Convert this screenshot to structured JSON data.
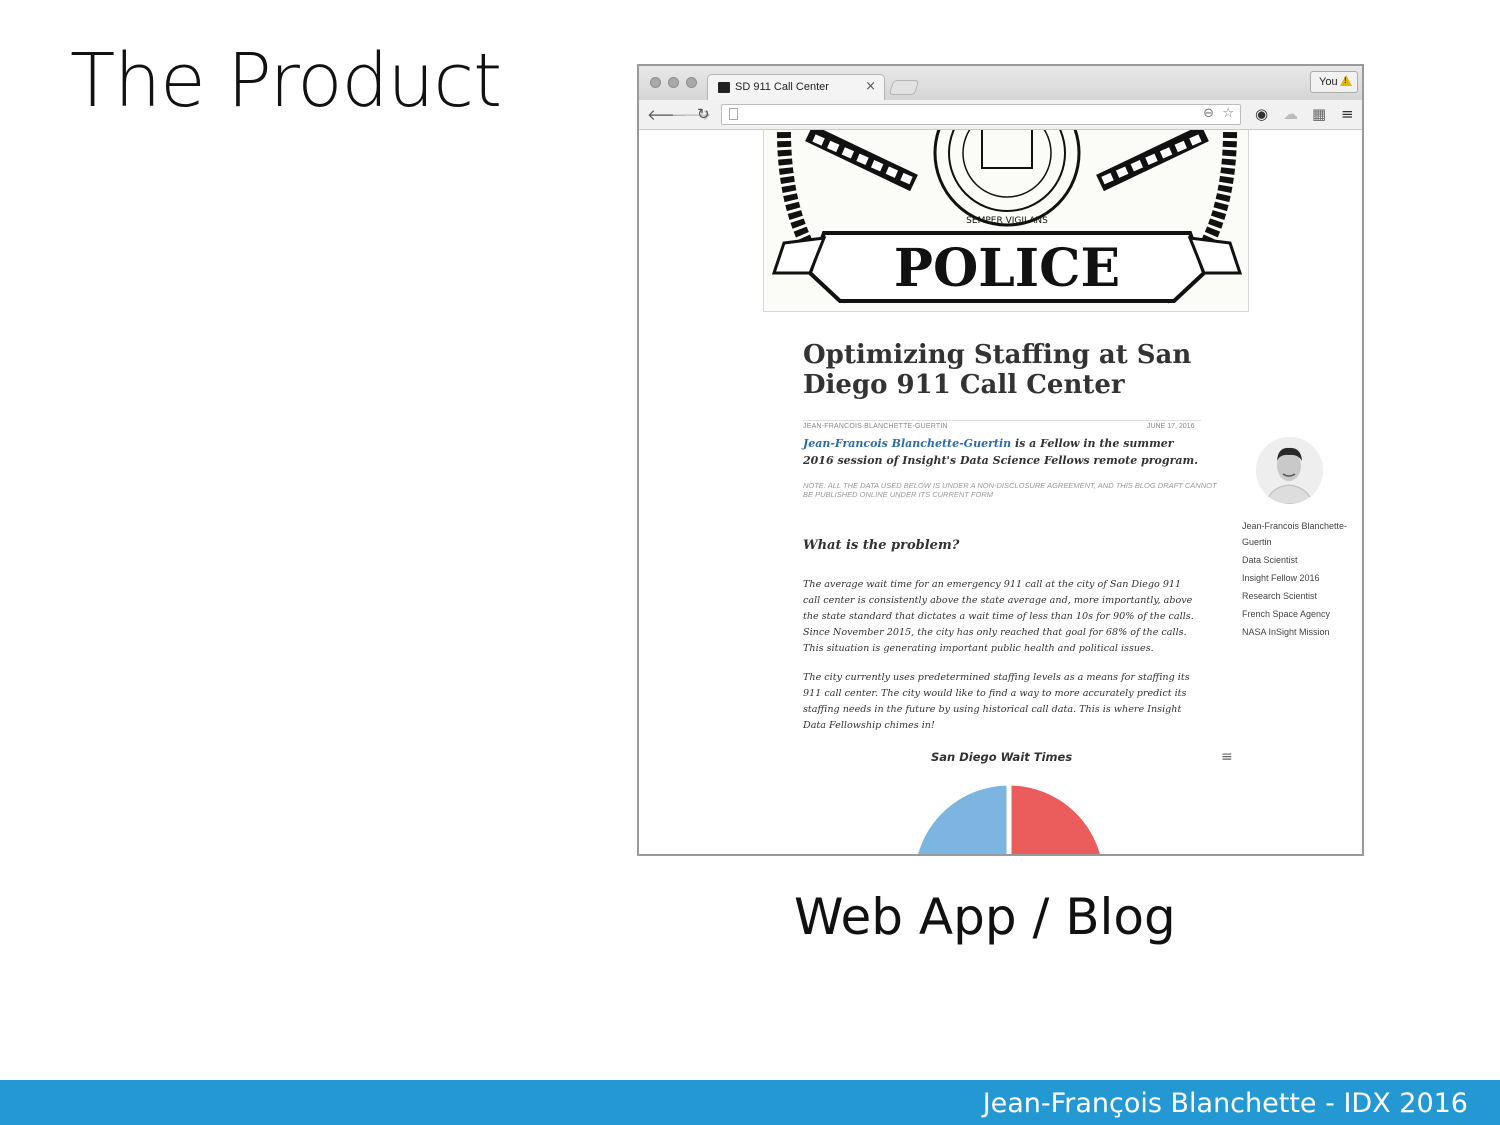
{
  "slide": {
    "title": "The Product",
    "caption": "Web App / Blog",
    "footer": "Jean-François Blanchette - IDX 2016"
  },
  "browser": {
    "tab_title": "SD 911 Call Center",
    "profile": "You",
    "icons": [
      "back-arrow-icon",
      "forward-arrow-icon",
      "reload-icon",
      "page-icon",
      "zoom-icon",
      "star-icon",
      "extension-icon",
      "cloud-icon",
      "translate-icon",
      "menu-icon"
    ]
  },
  "post": {
    "hero_text": "POLICE",
    "seal_ring_text": "SEMPER VIGILANS",
    "title": "Optimizing Staffing at San Diego 911 Call Center",
    "author_caps": "JEAN-FRANCOIS BLANCHETTE-GUERTIN",
    "date": "JUNE 17, 2016",
    "intro_link": "Jean-Francois Blanchette-Guertin",
    "intro_rest": " is a Fellow in the summer 2016 session of Insight's Data Science Fellows remote program.",
    "note": "NOTE: ALL THE DATA USED BELOW IS UNDER A NON-DISCLOSURE AGREEMENT, AND THIS BLOG DRAFT CANNOT BE PUBLISHED ONLINE UNDER ITS CURRENT FORM",
    "section_heading": "What is the problem?",
    "para1": "The average wait time for an emergency 911 call at the city of San Diego 911 call center is consistently above the state average and, more importantly, above the state standard that dictates a wait time of less than 10s for 90% of the calls. Since November 2015, the city has only reached that goal for 68% of the calls. This situation is generating important public health and political issues.",
    "para2": "The city currently uses predetermined staffing levels as a means for staffing its 911 call center. The city would like to find a way to more accurately predict its staffing needs in the future by using historical call data. This is where Insight Data Fellowship chimes in!",
    "sidebar": [
      "Jean-Francois Blanchette-Guertin",
      "Data Scientist",
      "Insight Fellow 2016",
      "Research Scientist",
      "French Space Agency",
      "NASA InSight Mission"
    ],
    "chart_title": "San Diego Wait Times",
    "chart_colors": {
      "left": "#7cb5e0",
      "right": "#eb5c5d"
    }
  },
  "chart_data": {
    "type": "pie",
    "title": "San Diego Wait Times",
    "slices": [
      {
        "value": 50,
        "color": "#7cb5e0"
      },
      {
        "value": 50,
        "color": "#eb5c5d"
      }
    ]
  }
}
